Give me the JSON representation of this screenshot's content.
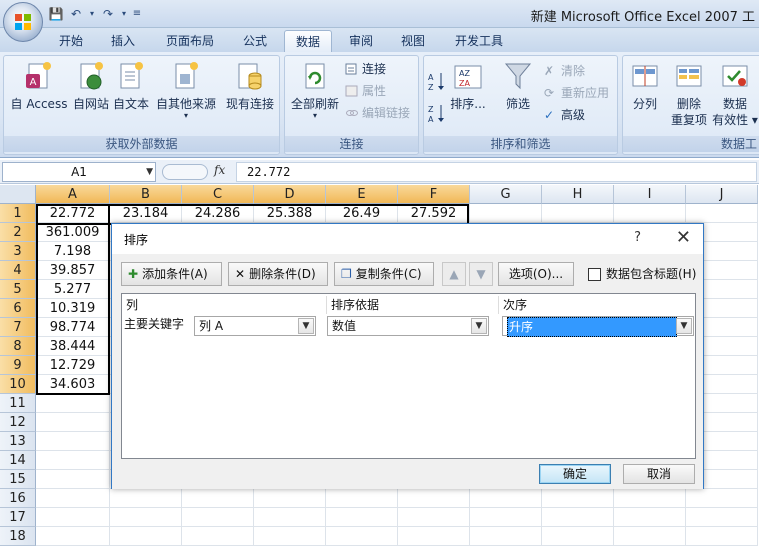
{
  "window": {
    "title": "新建 Microsoft Office Excel 2007 工"
  },
  "tabs": [
    "开始",
    "插入",
    "页面布局",
    "公式",
    "数据",
    "审阅",
    "视图",
    "开发工具"
  ],
  "active_tab": "数据",
  "ribbon": {
    "get_external": {
      "label": "获取外部数据",
      "buttons": [
        "自 Access",
        "自网站",
        "自文本",
        "自其他来源",
        "现有连接"
      ]
    },
    "connections": {
      "label": "连接",
      "refresh_all": "全部刷新",
      "connections": "连接",
      "properties": "属性",
      "edit_links": "编辑链接"
    },
    "sort_filter": {
      "label": "排序和筛选",
      "sort": "排序...",
      "filter": "筛选",
      "clear": "清除",
      "reapply": "重新应用",
      "advanced": "高级"
    },
    "data_tools": {
      "label": "数据工",
      "split": "分列",
      "remove_dup_1": "删除",
      "remove_dup_2": "重复项",
      "validation_1": "数据",
      "validation_2": "有效性"
    }
  },
  "formula_bar": {
    "name_box": "A1",
    "fx": "fx",
    "content": "22.772"
  },
  "grid": {
    "columns": [
      "A",
      "B",
      "C",
      "D",
      "E",
      "F",
      "G",
      "H",
      "I",
      "J"
    ],
    "rows": [
      "1",
      "2",
      "3",
      "4",
      "5",
      "6",
      "7",
      "8",
      "9",
      "10",
      "11",
      "12",
      "13",
      "14",
      "15",
      "16",
      "17",
      "18"
    ],
    "row1": [
      "22.772",
      "23.184",
      "24.286",
      "25.388",
      "26.49",
      "27.592"
    ],
    "colA": [
      "22.772",
      "361.009",
      "7.198",
      "39.857",
      "5.277",
      "10.319",
      "98.774",
      "38.444",
      "12.729",
      "34.603"
    ]
  },
  "dialog": {
    "title": "排序",
    "help": "?",
    "close": "✕",
    "add_level": "添加条件(A)",
    "delete_level": "删除条件(D)",
    "copy_level": "复制条件(C)",
    "options": "选项(O)...",
    "has_headers": "数据包含标题(H)",
    "headers": {
      "column": "列",
      "sort_on": "排序依据",
      "order": "次序"
    },
    "row": {
      "label": "主要关键字",
      "column": "列 A",
      "sort_on": "数值",
      "order": "升序"
    },
    "ok": "确定",
    "cancel": "取消"
  }
}
